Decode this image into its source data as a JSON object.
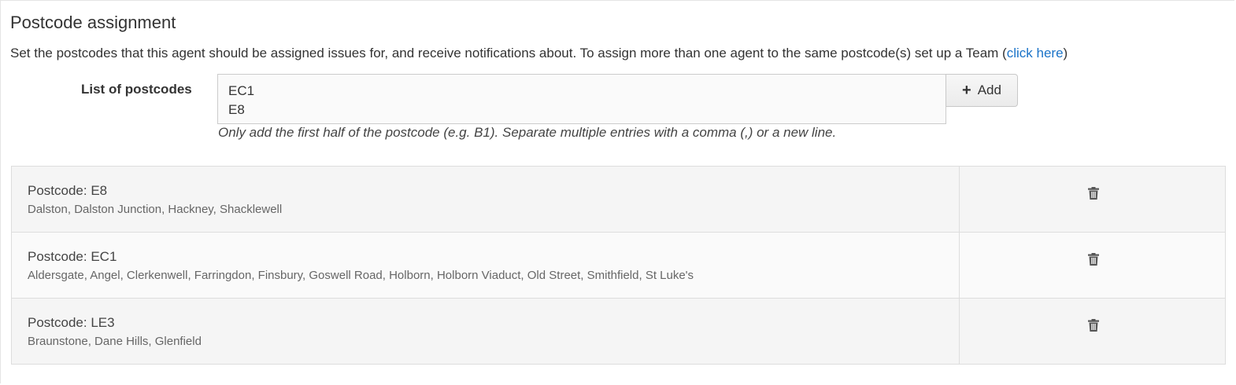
{
  "section": {
    "title": "Postcode assignment",
    "intro_text": "Set the postcodes that this agent should be assigned issues for, and receive notifications about. To assign more than one agent to the same postcode(s) set up a Team (",
    "intro_link": "click here",
    "intro_suffix": ")"
  },
  "form": {
    "label": "List of postcodes",
    "textarea_value": "EC1\nE8",
    "add_button_label": "Add",
    "add_icon": "plus-icon",
    "help_text": "Only add the first half of the postcode (e.g. B1). Separate multiple entries with a comma (,) or a new line."
  },
  "postcodes": [
    {
      "title": "Postcode: E8",
      "areas": "Dalston, Dalston Junction, Hackney, Shacklewell",
      "delete_icon": "trash-icon"
    },
    {
      "title": "Postcode: EC1",
      "areas": "Aldersgate, Angel, Clerkenwell, Farringdon, Finsbury, Goswell Road, Holborn, Holborn Viaduct, Old Street, Smithfield, St Luke's",
      "delete_icon": "trash-icon"
    },
    {
      "title": "Postcode: LE3",
      "areas": "Braunstone, Dane Hills, Glenfield",
      "delete_icon": "trash-icon"
    }
  ],
  "colors": {
    "link": "#1a73c8",
    "row_odd": "#f5f5f5",
    "row_even": "#fafafa",
    "border": "#dddddd"
  }
}
